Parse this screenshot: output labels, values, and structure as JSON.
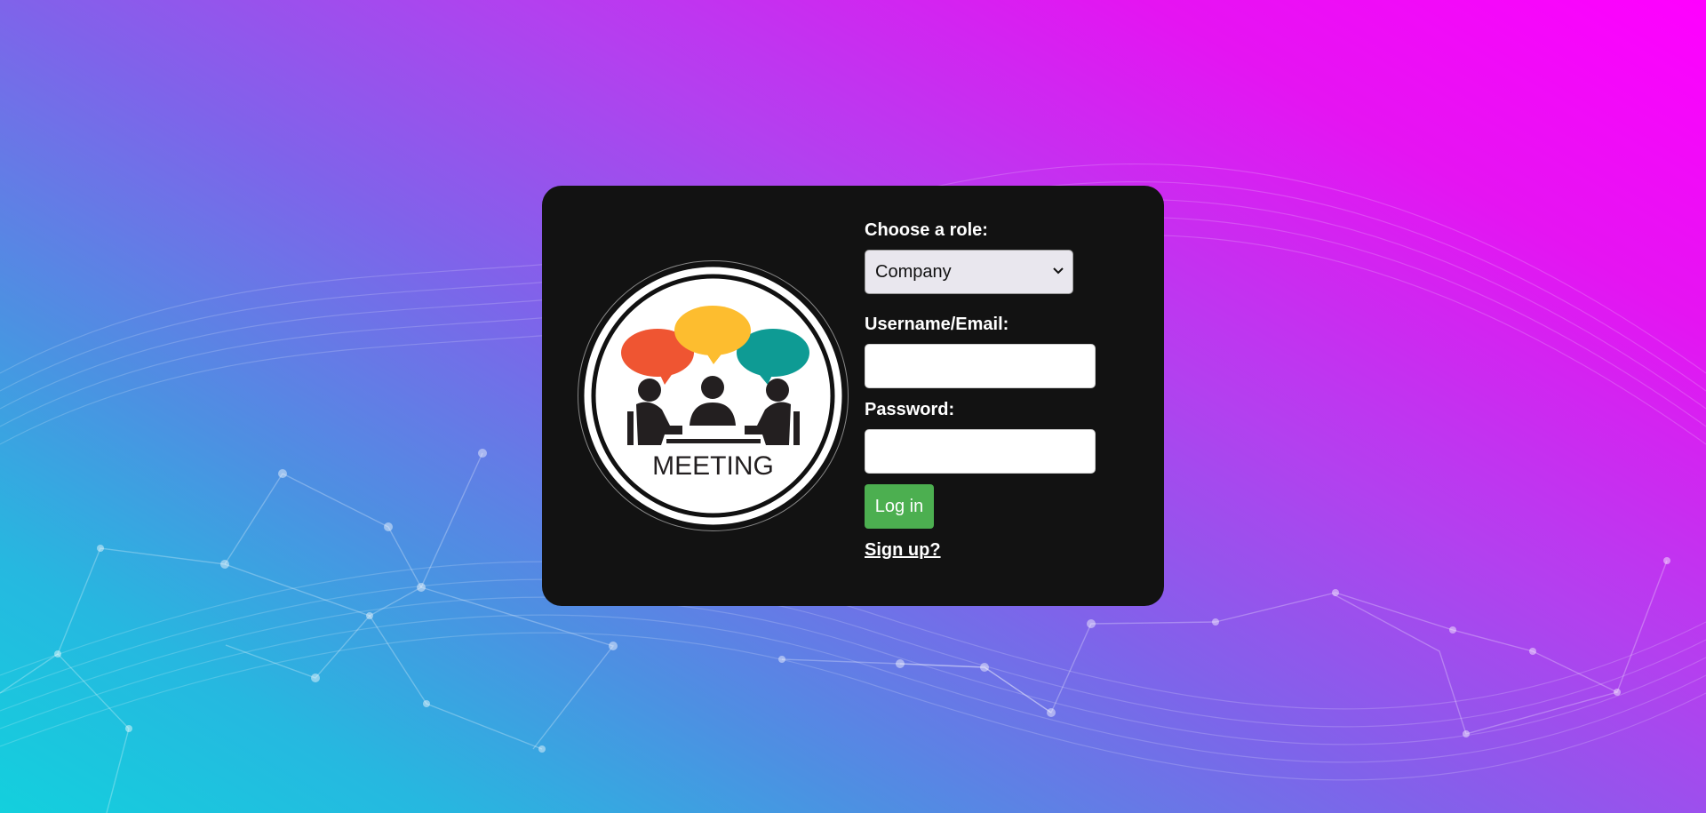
{
  "login_card": {
    "logo_text": "MEETING",
    "role": {
      "label": "Choose a role:",
      "selected": "Company"
    },
    "username": {
      "label": "Username/Email:",
      "value": ""
    },
    "password": {
      "label": "Password:",
      "value": ""
    },
    "login_button": "Log in",
    "signup_link": "Sign up?"
  },
  "colors": {
    "card_background": "#121212",
    "login_button": "#4caf50",
    "bubble_red": "#ef5532",
    "bubble_yellow": "#fdbd2f",
    "bubble_teal": "#0e9b94",
    "gradient_top_right": "#ff00ff",
    "gradient_bottom_left": "#13d0dd"
  }
}
